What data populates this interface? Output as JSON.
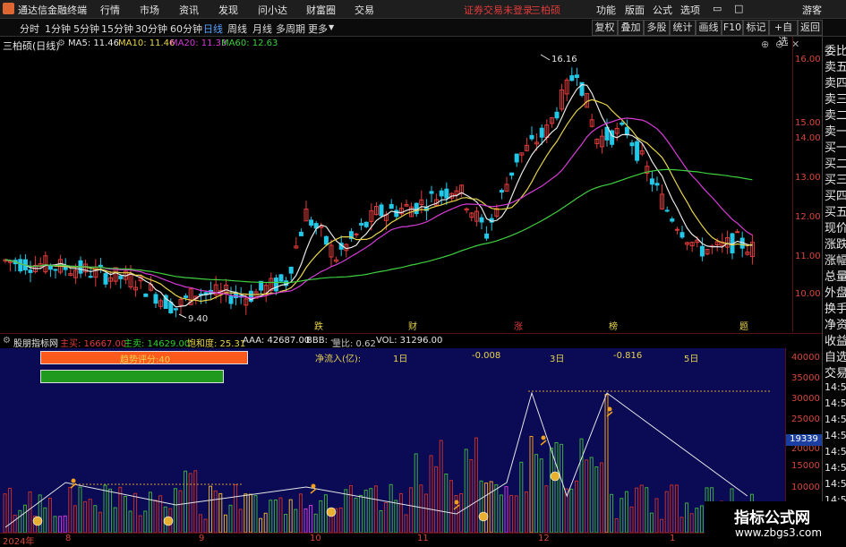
{
  "titlebar": {
    "app_name": "通达信金融终端",
    "menus": [
      "行情",
      "市场",
      "资讯",
      "发现",
      "问小达",
      "财富圈",
      "交易"
    ],
    "status_text": "证券交易未登录",
    "stock_name": "三柏硕",
    "right_menus": [
      "功能",
      "版面",
      "公式",
      "选项"
    ],
    "user": "游客"
  },
  "toolbar": {
    "periods": [
      "分时",
      "1分钟",
      "5分钟",
      "15分钟",
      "30分钟",
      "60分钟",
      "日线",
      "周线",
      "月线",
      "多周期",
      "更多"
    ],
    "active_period": "日线",
    "buttons": [
      "复权",
      "叠加",
      "多股",
      "统计",
      "画线",
      "F10",
      "标记",
      "+自选",
      "返回"
    ]
  },
  "main_chart": {
    "title": "三柏硕(日线)",
    "ma": [
      {
        "label": "MA5: 11.46",
        "color": "#e8e8e8"
      },
      {
        "label": "MA10: 11.46",
        "color": "#e8d44a"
      },
      {
        "label": "MA20: 11.33",
        "color": "#d63bd6"
      },
      {
        "label": "MA60: 12.63",
        "color": "#3fcf3f"
      }
    ],
    "y_ticks": [
      "16.00",
      "15.00",
      "14.00",
      "13.00",
      "12.00",
      "11.00",
      "10.00"
    ],
    "high_label": "16.16",
    "low_label": "9.40",
    "markers": [
      "跌",
      "财",
      "涨",
      "榜",
      "题"
    ]
  },
  "indicator": {
    "name": "股朋指标网",
    "stats": [
      {
        "label": "主买: 16667.00",
        "color": "#e23b3b"
      },
      {
        "label": "主卖: 14629.00",
        "color": "#2fcf2f"
      },
      {
        "label": "饱和度: 25.31",
        "color": "#e8d44a"
      },
      {
        "label": "AAA: 42687.00",
        "color": "#e6e6e6"
      },
      {
        "label": "BBB: -",
        "color": "#e6e6e6"
      },
      {
        "label": "量比: 0.62",
        "color": "#c8c8c8"
      },
      {
        "label": "VOL: 31296.00",
        "color": "#e6e6e6"
      }
    ],
    "trend_label": "趋势评分:40",
    "trend_score": 40,
    "netflow_label": "净流入(亿):",
    "netflow": [
      {
        "period": "1日",
        "value": "-0.008"
      },
      {
        "period": "3日",
        "value": "-0.816"
      },
      {
        "period": "5日",
        "value": ""
      }
    ],
    "y_ticks": [
      "40000",
      "35000",
      "30000",
      "25000",
      "20000",
      "15000",
      "10000"
    ],
    "current_value": "19339"
  },
  "x_axis": {
    "labels": [
      "2024年",
      "8",
      "9",
      "10",
      "11",
      "12",
      "1"
    ]
  },
  "right_panel": {
    "items": [
      "委比",
      "卖五",
      "卖四",
      "卖三",
      "卖二",
      "卖一",
      "买一",
      "买二",
      "买三",
      "买四",
      "买五",
      "现价",
      "涨跌",
      "涨幅",
      "总量",
      "外盘",
      "换手",
      "净资",
      "收益",
      "自选",
      "交易"
    ],
    "times": [
      "14:56",
      "14:56",
      "14:56",
      "14:56",
      "14:56",
      "14:56",
      "14:56",
      "14:56"
    ]
  },
  "watermark": {
    "title": "指标公式网",
    "url": "www.zbgs3.com"
  },
  "colors": {
    "up": "#e23b3b",
    "down": "#22c8e8",
    "ma5": "#e8e8e8",
    "ma10": "#e8d44a",
    "ma20": "#d63bd6",
    "ma60": "#3fcf3f"
  }
}
